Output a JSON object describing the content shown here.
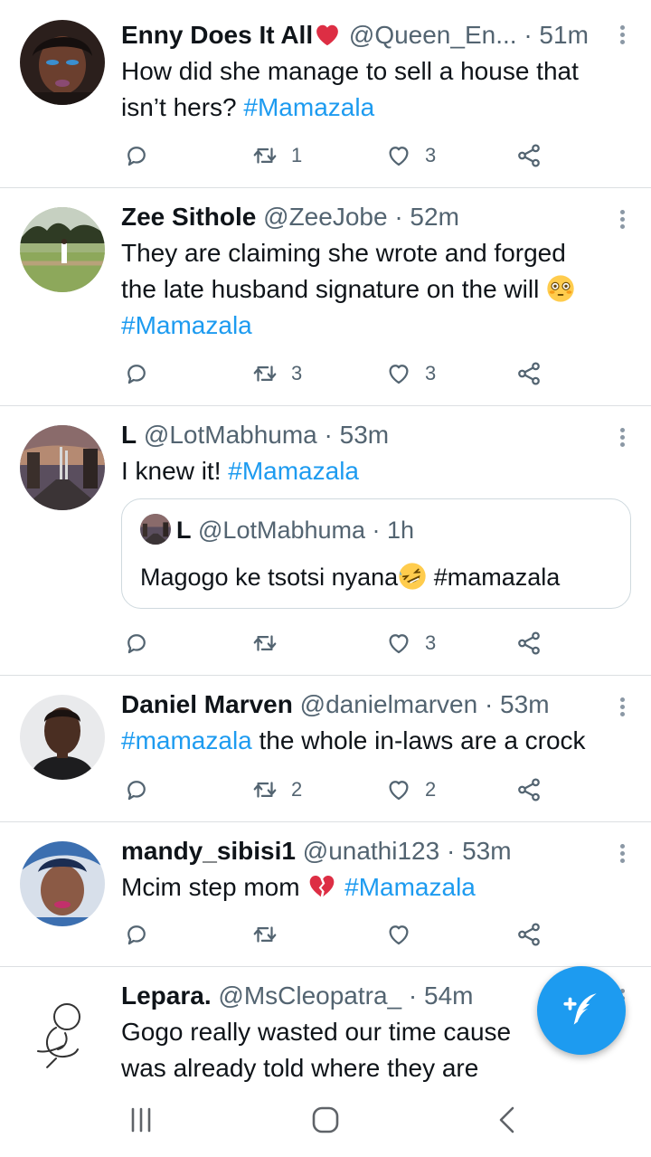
{
  "tweets": [
    {
      "name": "Enny Does It All",
      "handle": "@Queen_En... · 51m",
      "text_lines": [
        "How did she manage to sell a house that",
        "isn’t hers? "
      ],
      "tags": [
        "#Mamazala"
      ],
      "counts": {
        "reply": "",
        "retweet": "1",
        "like": "3"
      }
    },
    {
      "name": "Zee Sithole",
      "handle": "@ZeeJobe · 52m",
      "text_lines": [
        "They are claiming she wrote and forged",
        "the late husband signature on the will "
      ],
      "tags": [
        "#Mamazala"
      ],
      "counts": {
        "reply": "",
        "retweet": "3",
        "like": "3"
      }
    },
    {
      "name": "L",
      "handle": "@LotMabhuma · 53m",
      "text_lines": [
        "I knew it! "
      ],
      "tags": [
        "#Mamazala"
      ],
      "quote": {
        "name": "L",
        "handle": "@LotMabhuma · 1h",
        "text": "Magogo ke tsotsi nyana",
        "tag": " #mamazala"
      },
      "counts": {
        "reply": "",
        "retweet": "",
        "like": "3"
      }
    },
    {
      "name": "Daniel Marven",
      "handle": "@danielmarven · 53m",
      "text_lines": [
        " the whole in-laws are a crock"
      ],
      "tags": [
        "#mamazala"
      ],
      "counts": {
        "reply": "",
        "retweet": "2",
        "like": "2"
      }
    },
    {
      "name": "mandy_sibisi1",
      "handle": "@unathi123 · 53m",
      "text_lines": [
        "Mcim step mom "
      ],
      "tags": [
        "#Mamazala"
      ],
      "counts": {
        "reply": "",
        "retweet": "",
        "like": ""
      }
    },
    {
      "name": "Lepara.",
      "handle": "@MsCleopatra_ · 54m",
      "text_lines": [
        "Gogo really wasted our time cause",
        "was already told where they are"
      ]
    }
  ],
  "icons": {
    "reply": "reply-icon",
    "retweet": "retweet-icon",
    "like": "heart-icon",
    "share": "share-icon",
    "more": "more-vertical-icon",
    "compose": "compose-tweet-icon",
    "nav_recents": "recents-icon",
    "nav_home": "home-icon",
    "nav_back": "back-icon"
  },
  "colors": {
    "accent": "#1d9bf0",
    "muted": "#536471",
    "text": "#0f1419",
    "divider": "#dcdfe2"
  }
}
